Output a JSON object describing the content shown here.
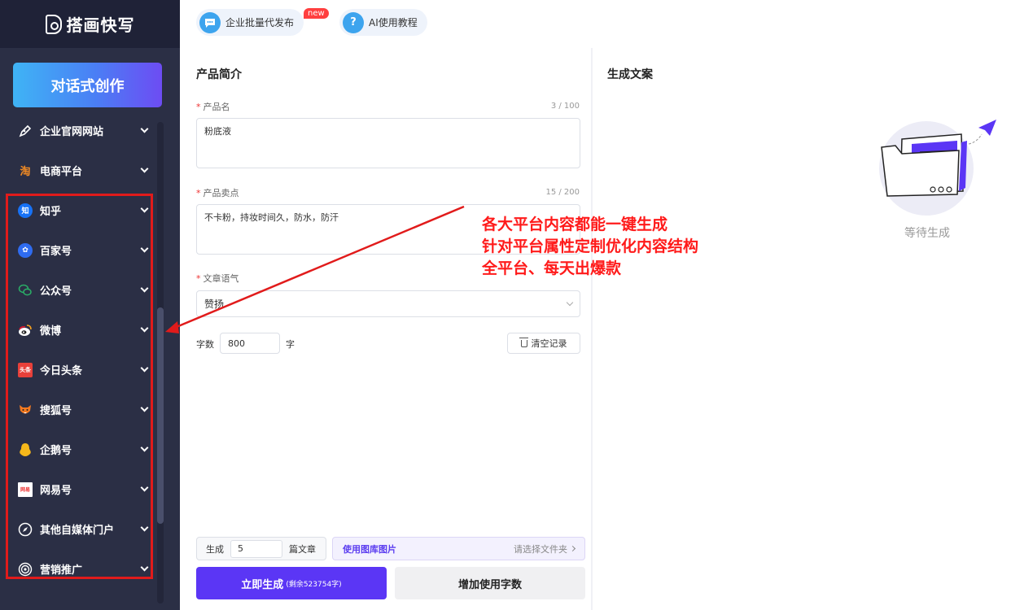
{
  "sidebar": {
    "logo": "搭画快写",
    "cta": "对话式创作",
    "items": [
      {
        "label": "企业官网网站",
        "icon": "pen-icon",
        "color": "#2b2f45"
      },
      {
        "label": "电商平台",
        "icon": "taobao-icon",
        "color": "#f08a24"
      },
      {
        "label": "知乎",
        "icon": "zhihu-icon",
        "color": "#1772f6"
      },
      {
        "label": "百家号",
        "icon": "baijiahao-icon",
        "color": "#2f6cf0"
      },
      {
        "label": "公众号",
        "icon": "wechat-icon",
        "color": "#2aae67"
      },
      {
        "label": "微博",
        "icon": "weibo-icon",
        "color": "#e6162d"
      },
      {
        "label": "今日头条",
        "icon": "toutiao-icon",
        "color": "#e8403a"
      },
      {
        "label": "搜狐号",
        "icon": "sohu-fox-icon",
        "color": "#f47a20"
      },
      {
        "label": "企鹅号",
        "icon": "penguin-icon",
        "color": "#f6b81b"
      },
      {
        "label": "网易号",
        "icon": "netease-icon",
        "color": "#e33"
      },
      {
        "label": "其他自媒体门户",
        "icon": "compass-icon",
        "color": "#2b2f45"
      },
      {
        "label": "营销推广",
        "icon": "target-icon",
        "color": "#2b2f45"
      }
    ]
  },
  "topbar": {
    "pill1": "企业批量代发布",
    "new_badge": "new",
    "pill2": "AI使用教程"
  },
  "form": {
    "title": "产品简介",
    "product_name_label": "产品名",
    "product_name_count": "3 / 100",
    "product_name_value": "粉底液",
    "selling_points_label": "产品卖点",
    "selling_points_count": "15 / 200",
    "selling_points_value": "不卡粉，持妆时间久，防水，防汗",
    "tone_label": "文章语气",
    "tone_value": "赞扬",
    "word_count_label": "字数",
    "word_count_value": "800",
    "word_unit": "字",
    "clear_label": "清空记录",
    "generate_label": "生成",
    "generate_count": "5",
    "generate_unit": "篇文章",
    "image_lib_label": "使用图库图片",
    "folder_select": "请选择文件夹",
    "submit_label": "立即生成",
    "submit_remaining": "(剩余523754字)",
    "add_words_label": "增加使用字数"
  },
  "output": {
    "title": "生成文案",
    "waiting": "等待生成"
  },
  "annotation": {
    "line1": "各大平台内容都能一键生成",
    "line2": "针对平台属性定制优化内容结构",
    "line3": "全平台、每天出爆款"
  },
  "colors": {
    "accent": "#5b36f5",
    "sidebar_bg": "#2b2f45",
    "annotation_red": "#ff1a1a"
  }
}
